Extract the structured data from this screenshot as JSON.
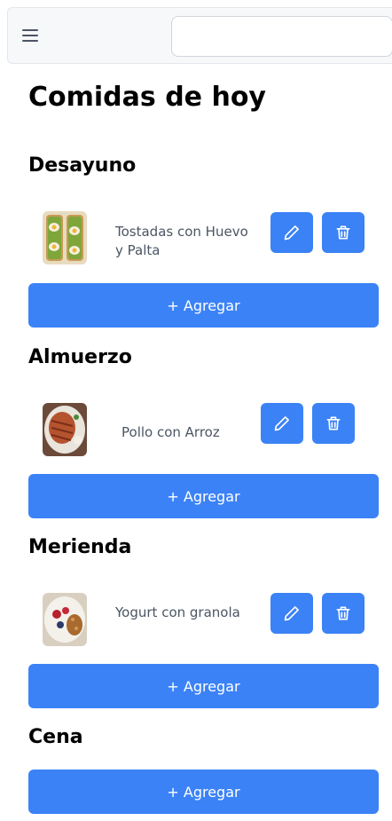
{
  "header": {
    "menu_icon": "hamburger-icon",
    "search_value": "",
    "search_placeholder": ""
  },
  "page_title": "Comidas de hoy",
  "sections": [
    {
      "title": "Desayuno",
      "items": [
        {
          "name": "Tostadas con Huevo y Palta",
          "image": "avocado-egg-toast",
          "edit_icon": "pencil-icon",
          "delete_icon": "trash-icon"
        }
      ],
      "add_label": "+ Agregar"
    },
    {
      "title": "Almuerzo",
      "items": [
        {
          "name": "Pollo con Arroz",
          "image": "chicken-rice",
          "edit_icon": "pencil-icon",
          "delete_icon": "trash-icon"
        }
      ],
      "add_label": "+ Agregar"
    },
    {
      "title": "Merienda",
      "items": [
        {
          "name": "Yogurt con granola",
          "image": "yogurt-granola",
          "edit_icon": "pencil-icon",
          "delete_icon": "trash-icon"
        }
      ],
      "add_label": "+ Agregar"
    },
    {
      "title": "Cena",
      "items": [],
      "add_label": "+ Agregar"
    }
  ],
  "colors": {
    "accent": "#3b82f6",
    "text_muted": "#4b5563",
    "topbar_bg": "#f7f8fa"
  }
}
